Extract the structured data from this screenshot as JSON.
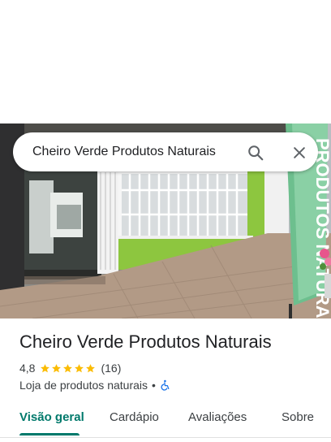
{
  "search": {
    "query": "Cheiro Verde Produtos Naturais",
    "search_icon": "search-icon",
    "close_icon": "close-icon"
  },
  "photo": {
    "banner_text": "PRODUTOS NATURA"
  },
  "place": {
    "name": "Cheiro Verde Produtos Naturais",
    "rating": "4,8",
    "stars": 5,
    "review_count": "(16)",
    "category": "Loja de produtos naturais",
    "separator": "•",
    "accessibility_icon": "wheelchair-icon"
  },
  "tabs": [
    {
      "label": "Visão geral",
      "active": true
    },
    {
      "label": "Cardápio",
      "active": false
    },
    {
      "label": "Avaliações",
      "active": false
    },
    {
      "label": "Sobre",
      "active": false
    }
  ],
  "colors": {
    "accent": "#00796b",
    "star": "#fbbc04",
    "accessibility": "#1a73e8",
    "wall_green": "#8dc63f"
  }
}
